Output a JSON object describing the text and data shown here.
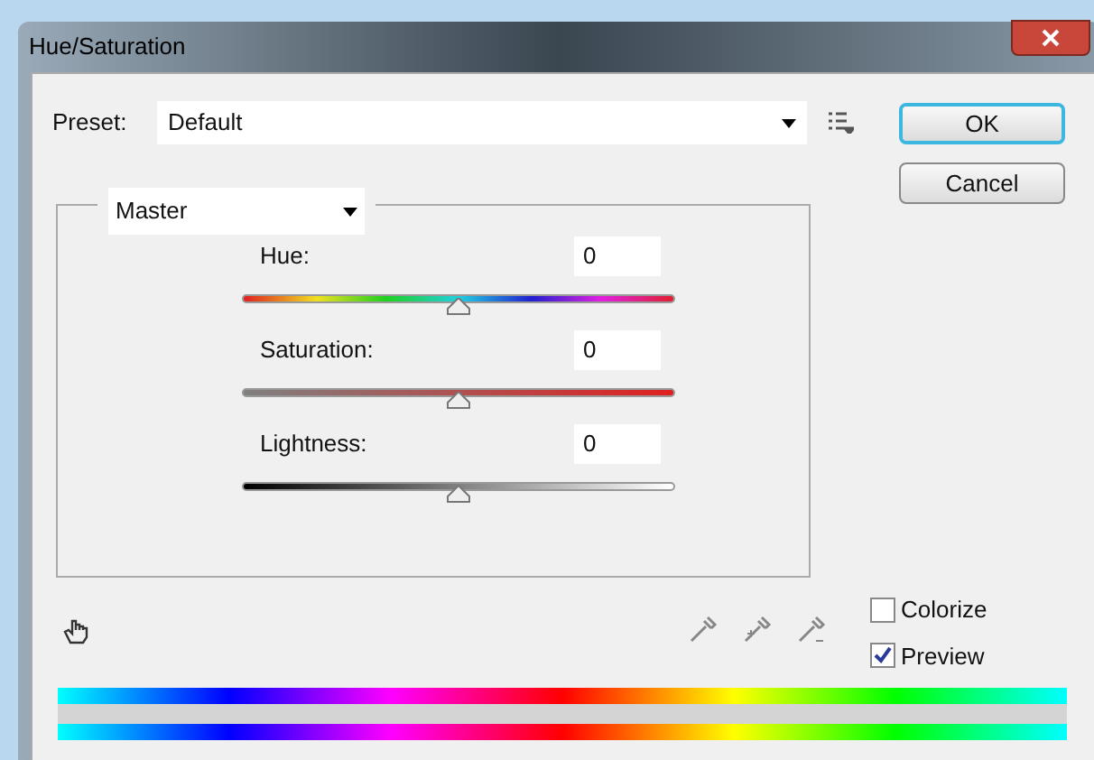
{
  "window": {
    "title": "Hue/Saturation"
  },
  "preset": {
    "label": "Preset:",
    "value": "Default"
  },
  "buttons": [
    {
      "label": "OK",
      "default": true
    },
    {
      "label": "Cancel",
      "default": false
    }
  ],
  "channel": {
    "value": "Master"
  },
  "sliders": [
    {
      "kind": "hue",
      "label": "Hue:",
      "value": "0",
      "level": 0.5
    },
    {
      "kind": "saturation",
      "label": "Saturation:",
      "value": "0",
      "level": 0.5
    },
    {
      "kind": "lightness",
      "label": "Lightness:",
      "value": "0",
      "level": 0.5
    }
  ],
  "options": [
    {
      "label": "Colorize",
      "checked": false
    },
    {
      "label": "Preview",
      "checked": true
    }
  ]
}
